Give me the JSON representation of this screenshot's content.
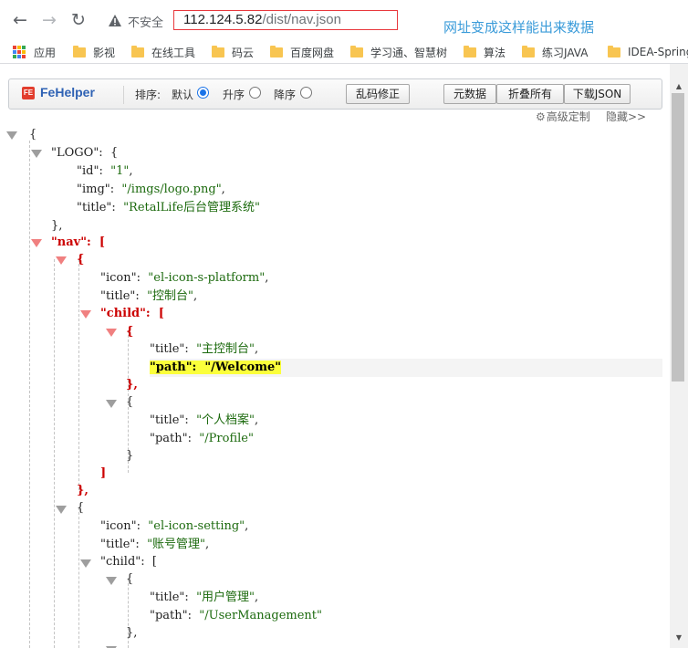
{
  "browser": {
    "insecure_label": "不安全",
    "url_host": "112.124.5.82",
    "url_path": "/dist/nav.json",
    "annotation": "网址变成这样能出来数据"
  },
  "bookmarks": [
    {
      "label": "应用",
      "icon": "apps-grid-icon"
    },
    {
      "label": "影视",
      "icon": "folder-icon"
    },
    {
      "label": "在线工具",
      "icon": "folder-icon"
    },
    {
      "label": "码云",
      "icon": "folder-icon"
    },
    {
      "label": "百度网盘",
      "icon": "folder-icon"
    },
    {
      "label": "学习通、智慧树",
      "icon": "folder-icon"
    },
    {
      "label": "算法",
      "icon": "folder-icon"
    },
    {
      "label": "练习JAVA",
      "icon": "folder-icon"
    },
    {
      "label": "IDEA-Spring",
      "icon": "folder-icon"
    }
  ],
  "fehelper": {
    "name": "FeHelper",
    "logo_text": "FE",
    "sort_label": "排序:",
    "opt_default": "默认",
    "opt_asc": "升序",
    "opt_desc": "降序",
    "selected": "默认",
    "btn_fix": "乱码修正",
    "btn_raw": "元数据",
    "btn_fold": "折叠所有",
    "btn_download": "下载JSON",
    "link_advanced": "高级定制",
    "link_hide": "隐藏>>"
  },
  "json": {
    "open_brace": "{",
    "logo_key": "\"LOGO\"",
    "id_key": "\"id\"",
    "id_val": "\"1\"",
    "img_key": "\"img\"",
    "img_val": "\"/imgs/logo.png\"",
    "title_key": "\"title\"",
    "logo_title": "\"RetalLife后台管理系统\"",
    "nav_key": "\"nav\"",
    "icon_key": "\"icon\"",
    "child_key": "\"child\"",
    "path_key": "\"path\"",
    "nav0_icon": "\"el-icon-s-platform\"",
    "nav0_title": "\"控制台\"",
    "c00_title": "\"主控制台\"",
    "c00_path": "\"/Welcome\"",
    "c01_title": "\"个人档案\"",
    "c01_path": "\"/Profile\"",
    "nav1_icon": "\"el-icon-setting\"",
    "nav1_title": "\"账号管理\"",
    "c10_title": "\"用户管理\"",
    "c10_path": "\"/UserManagement\""
  },
  "colors": {
    "accent_red": "#cc0000",
    "string_green": "#1c6a0e",
    "highlight_yellow": "#fbff3b",
    "url_box_border": "#e8383d",
    "annotation_blue": "#3a9bd9"
  }
}
